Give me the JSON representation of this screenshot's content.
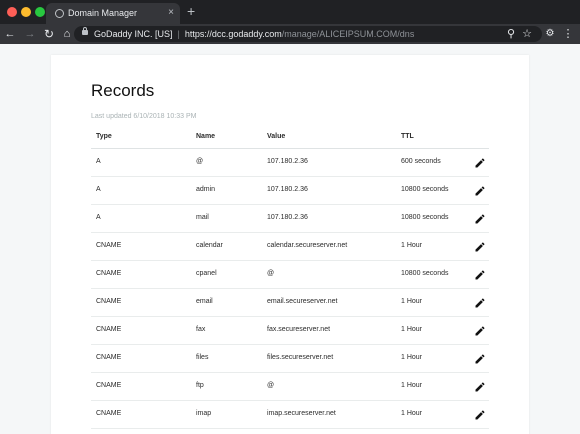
{
  "browser": {
    "tab_title": "Domain Manager",
    "tab_close": "×",
    "new_tab": "+",
    "site_identity": "GoDaddy INC. [US]",
    "url_separator": "|",
    "url_host": "https://dcc.godaddy.com",
    "url_path": "/manage/ALICEIPSUM.COM/dns"
  },
  "page": {
    "title": "Records",
    "last_updated": "Last updated 6/10/2018 10:33 PM",
    "columns": {
      "type": "Type",
      "name": "Name",
      "value": "Value",
      "ttl": "TTL"
    },
    "records": [
      {
        "type": "A",
        "name": "@",
        "value": "107.180.2.36",
        "ttl": "600 seconds"
      },
      {
        "type": "A",
        "name": "admin",
        "value": "107.180.2.36",
        "ttl": "10800 seconds"
      },
      {
        "type": "A",
        "name": "mail",
        "value": "107.180.2.36",
        "ttl": "10800 seconds"
      },
      {
        "type": "CNAME",
        "name": "calendar",
        "value": "calendar.secureserver.net",
        "ttl": "1 Hour"
      },
      {
        "type": "CNAME",
        "name": "cpanel",
        "value": "@",
        "ttl": "10800 seconds"
      },
      {
        "type": "CNAME",
        "name": "email",
        "value": "email.secureserver.net",
        "ttl": "1 Hour"
      },
      {
        "type": "CNAME",
        "name": "fax",
        "value": "fax.secureserver.net",
        "ttl": "1 Hour"
      },
      {
        "type": "CNAME",
        "name": "files",
        "value": "files.secureserver.net",
        "ttl": "1 Hour"
      },
      {
        "type": "CNAME",
        "name": "ftp",
        "value": "@",
        "ttl": "1 Hour"
      },
      {
        "type": "CNAME",
        "name": "imap",
        "value": "imap.secureserver.net",
        "ttl": "1 Hour"
      }
    ]
  },
  "colors": {
    "accent_pencil": "#111111",
    "muted_text": "#aab3b5"
  },
  "icons": {
    "edit": "pencil-icon"
  }
}
